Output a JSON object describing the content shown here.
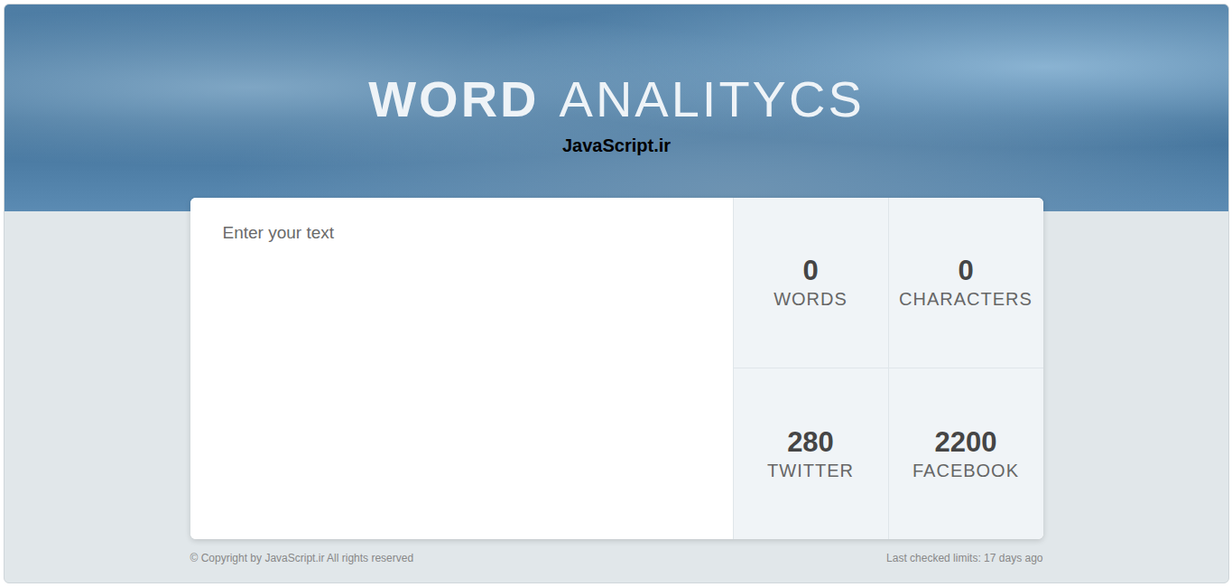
{
  "header": {
    "title_bold": "WORD",
    "title_light": "ANALITYCS",
    "subtitle": "JavaScript.ir"
  },
  "editor": {
    "placeholder": "Enter your text"
  },
  "stats": [
    {
      "value": "0",
      "label": "WORDS"
    },
    {
      "value": "0",
      "label": "CHARACTERS"
    },
    {
      "value": "280",
      "label": "TWITTER"
    },
    {
      "value": "2200",
      "label": "FACEBOOK"
    }
  ],
  "footer": {
    "copyright": "© Copyright by JavaScript.ir All rights reserved",
    "last_checked": "Last checked limits: 17 days ago"
  }
}
